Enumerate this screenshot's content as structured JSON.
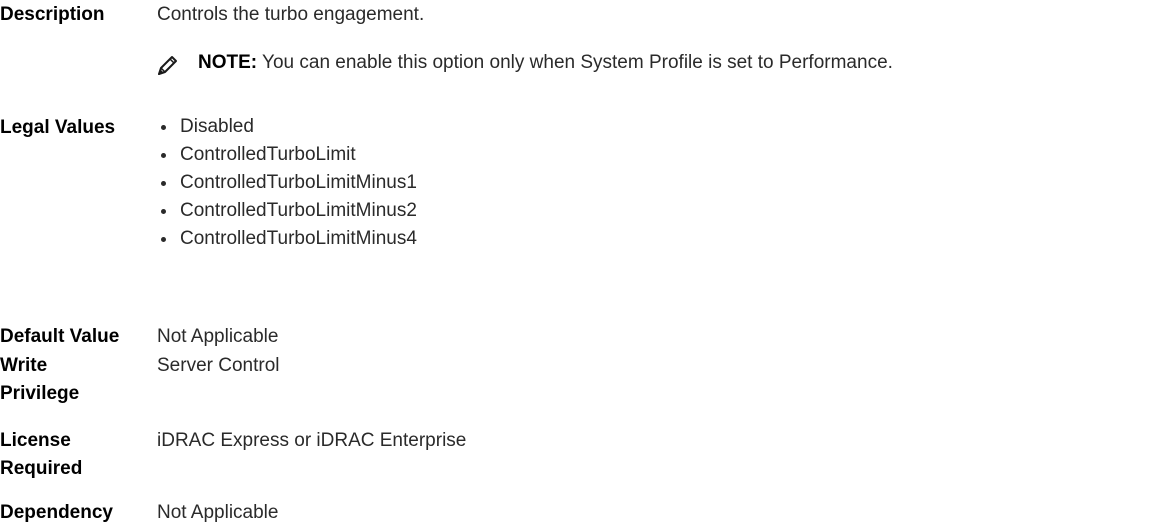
{
  "description": {
    "label": "Description",
    "text": "Controls the turbo engagement.",
    "note_icon": "pencil-note-icon",
    "note_label": "NOTE:",
    "note_text": " You can enable this option only when System Profile is set to Performance."
  },
  "legal_values": {
    "label": "Legal Values",
    "items": [
      "Disabled",
      "ControlledTurboLimit",
      "ControlledTurboLimitMinus1",
      "ControlledTurboLimitMinus2",
      "ControlledTurboLimitMinus4"
    ]
  },
  "default_value": {
    "label": "Default Value",
    "text": "Not Applicable"
  },
  "write_privilege": {
    "label_line1": "Write",
    "label_line2": "Privilege",
    "text": "Server Control"
  },
  "license_required": {
    "label_line1": "License",
    "label_line2": "Required",
    "text": "iDRAC Express or iDRAC Enterprise"
  },
  "dependency": {
    "label": "Dependency",
    "text": "Not Applicable"
  }
}
